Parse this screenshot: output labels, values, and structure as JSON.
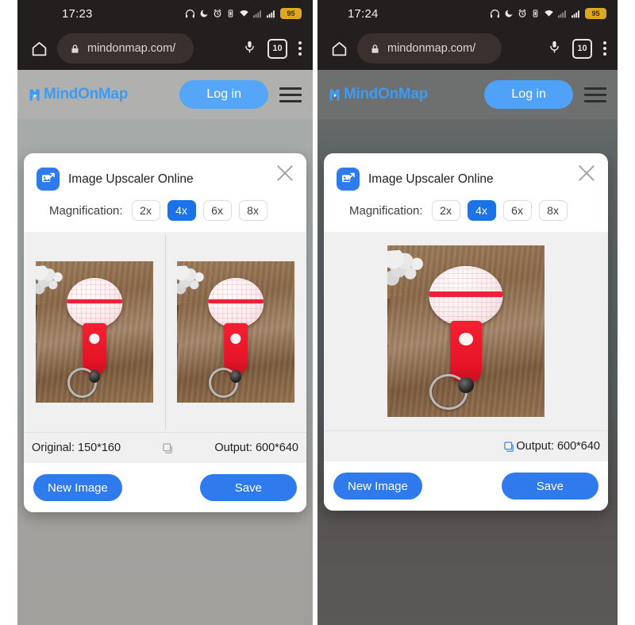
{
  "phones": [
    {
      "id": "left",
      "status": {
        "clock": "17:23",
        "battery": "95",
        "icons": [
          "headphones-icon",
          "moon-dnd-icon",
          "alarm-icon",
          "vibrate-icon",
          "wifi-icon",
          "signal-1-icon",
          "signal-2-icon",
          "battery-icon"
        ]
      },
      "browser": {
        "url": "mindonmap.com/",
        "tab_count": "10",
        "home_icon": "home-icon",
        "lock_icon": "lock-icon",
        "mic_icon": "microphone-icon",
        "menu_icon": "kebab-menu-icon"
      },
      "site": {
        "logo": "MindOnMap",
        "login_label": "Log in",
        "menu_icon": "hamburger-icon"
      },
      "dialog": {
        "title": "Image Upscaler Online",
        "close_icon": "close-icon",
        "app_icon": "image-upscaler-icon",
        "magnification_label": "Magnification:",
        "magnification_options": [
          "2x",
          "4x",
          "6x",
          "8x"
        ],
        "magnification_selected": "4x",
        "show_original_pane": true,
        "original_label": "Original: 150*160",
        "copy_icon": "compare-toggle-icon",
        "copy_icon_active": false,
        "output_label": "Output: 600*640",
        "new_image_label": "New Image",
        "save_label": "Save"
      }
    },
    {
      "id": "right",
      "status": {
        "clock": "17:24",
        "battery": "95",
        "icons": [
          "headphones-icon",
          "moon-dnd-icon",
          "alarm-icon",
          "vibrate-icon",
          "wifi-icon",
          "signal-1-icon",
          "signal-2-icon",
          "battery-icon"
        ]
      },
      "browser": {
        "url": "mindonmap.com/",
        "tab_count": "10",
        "home_icon": "home-icon",
        "lock_icon": "lock-icon",
        "mic_icon": "microphone-icon",
        "menu_icon": "kebab-menu-icon"
      },
      "site": {
        "logo": "MindOnMap",
        "login_label": "Log in",
        "menu_icon": "hamburger-icon"
      },
      "dialog": {
        "title": "Image Upscaler Online",
        "close_icon": "close-icon",
        "app_icon": "image-upscaler-icon",
        "magnification_label": "Magnification:",
        "magnification_options": [
          "2x",
          "4x",
          "6x",
          "8x"
        ],
        "magnification_selected": "4x",
        "show_original_pane": false,
        "original_label": "",
        "copy_icon": "compare-toggle-icon",
        "copy_icon_active": true,
        "output_label": "Output: 600*640",
        "new_image_label": "New Image",
        "save_label": "Save"
      }
    }
  ],
  "colors": {
    "brand_blue": "#3b9bf7",
    "primary_button": "#2f7bed",
    "selected_chip": "#1a73e8",
    "status_bar": "#231f1e",
    "battery_badge": "#e0a81f"
  },
  "photo": {
    "subject": "crochet-microphone-keychain-on-wood",
    "alt": "Red and white crocheted microphone keychain with ring on wooden background"
  }
}
